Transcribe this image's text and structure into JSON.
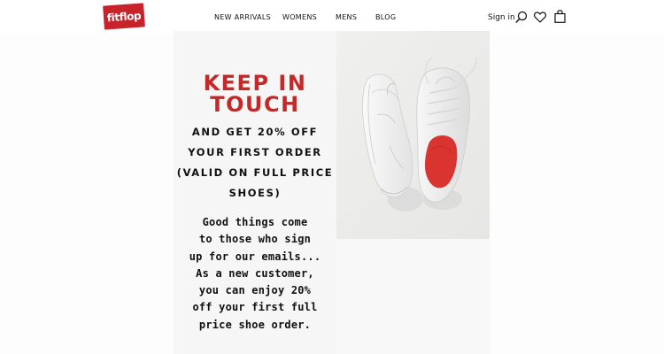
{
  "brand": {
    "logo_text": "fitflop",
    "logo_color": "#c8232b"
  },
  "nav": {
    "items": [
      {
        "label": "NEW ARRIVALS"
      },
      {
        "label": "WOMENS"
      },
      {
        "label": "MENS"
      },
      {
        "label": "BLOG"
      }
    ]
  },
  "utility": {
    "signin_label": "Sign in",
    "icons": [
      "search-icon",
      "heart-icon",
      "bag-icon"
    ]
  },
  "promo": {
    "headline_lines": [
      "KEEP IN",
      "TOUCH"
    ],
    "headline_color": "#c62828",
    "offer_lines": [
      "AND GET 20% OFF",
      "YOUR FIRST ORDER",
      "(VALID ON FULL PRICE",
      "SHOES)"
    ],
    "body_lines": [
      "Good things come",
      "to those who sign",
      "up for our emails...",
      "As a new customer,",
      "you can enjoy 20%",
      "off your first full",
      "price shoe order."
    ],
    "image": "white-sneakers-pair"
  }
}
